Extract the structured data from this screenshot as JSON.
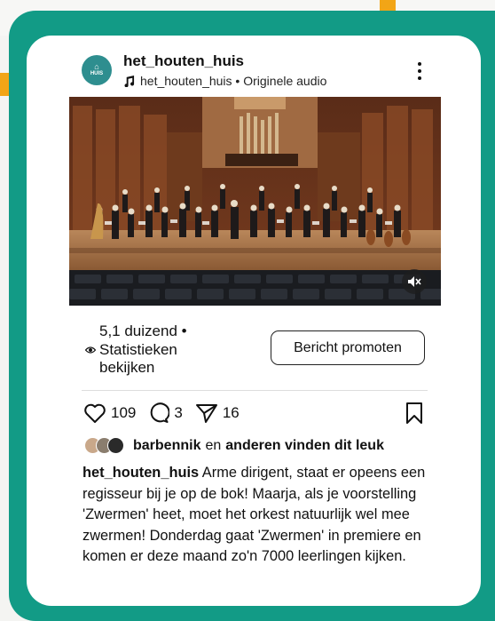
{
  "post": {
    "username": "het_houten_huis",
    "avatar_logo_text": "HUIS",
    "audio_label": "het_houten_huis • Originele audio",
    "views_count": "5,1 duizend •",
    "stats_link": "Statistieken bekijken",
    "promote_button": "Bericht promoten",
    "likes": "109",
    "comments": "3",
    "shares": "16",
    "liked_by_user": "barbennik",
    "liked_by_connector": "en",
    "liked_by_rest": "anderen vinden dit leuk",
    "caption_user": "het_houten_huis",
    "caption_text": "Arme dirigent, staat er opeens een regisseur bij je op de bok! Maarja, als je voorstelling 'Zwermen' heet, moet het orkest natuurlijk wel mee zwermen! Donderdag gaat 'Zwermen' in premiere en komen er deze maand zo'n 7000 leerlingen kijken."
  },
  "icons": {
    "music": "music-note-icon",
    "more": "more-vertical-icon",
    "mute": "speaker-muted-icon",
    "eye": "eye-icon",
    "like": "heart-icon",
    "comment": "comment-icon",
    "share": "send-icon",
    "save": "bookmark-icon"
  },
  "colors": {
    "frame": "#129b86",
    "accent": "#f2a516",
    "avatar": "#2e8e8f"
  }
}
